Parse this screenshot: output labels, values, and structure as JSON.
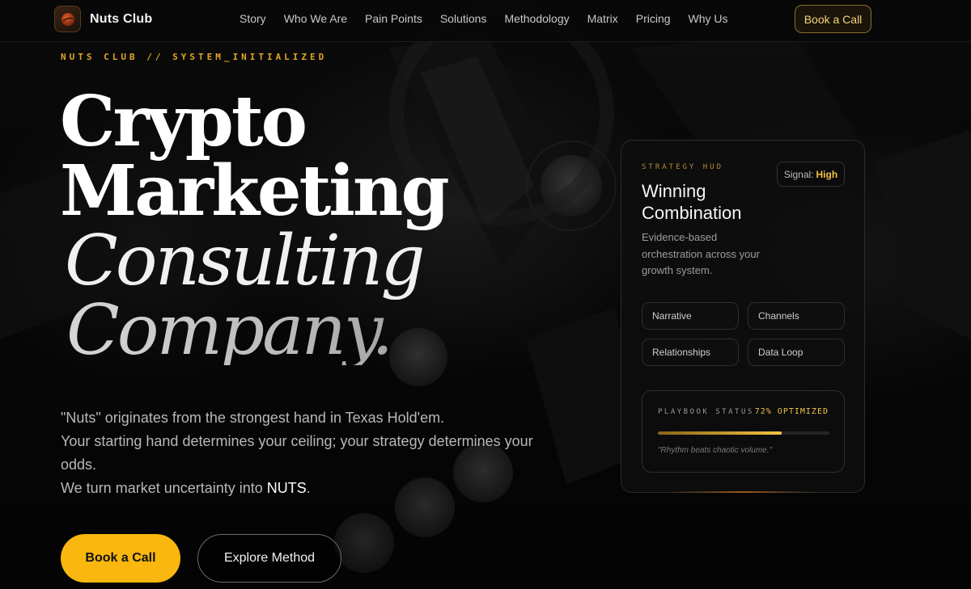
{
  "nav": {
    "brand": "Nuts Club",
    "links": [
      "Story",
      "Who We Are",
      "Pain Points",
      "Solutions",
      "Methodology",
      "Matrix",
      "Pricing",
      "Why Us"
    ],
    "cta": "Book a Call"
  },
  "hero": {
    "eyebrow": "NUTS CLUB // SYSTEM_INITIALIZED",
    "headline": {
      "line1": "Crypto",
      "line2": "Marketing",
      "line3": "Consulting",
      "line4": "Company."
    },
    "lede": {
      "p1": "\"Nuts\" originates from the strongest hand in Texas Hold'em.",
      "p2": "Your starting hand determines your ceiling; your strategy determines your odds.",
      "p3_prefix": "We turn market uncertainty into ",
      "p3_highlight": "NUTS",
      "p3_suffix": "."
    },
    "primary_button": "Book a Call",
    "secondary_button": "Explore Method"
  },
  "hud": {
    "label": "STRATEGY HUD",
    "signal_label": "Signal:",
    "signal_value": "High",
    "title": "Winning Combination",
    "description": "Evidence-based orchestration across your growth system.",
    "chips": [
      "Narrative",
      "Channels",
      "Relationships",
      "Data Loop"
    ],
    "playbook": {
      "label": "PLAYBOOK STATUS",
      "status": "72% OPTIMIZED",
      "progress": 0.72,
      "quote": "\"Rhythm beats chaotic volume.\""
    }
  },
  "colors": {
    "accent": "#F9B70F",
    "accent_text": "#E2A52A",
    "background": "#050505"
  }
}
